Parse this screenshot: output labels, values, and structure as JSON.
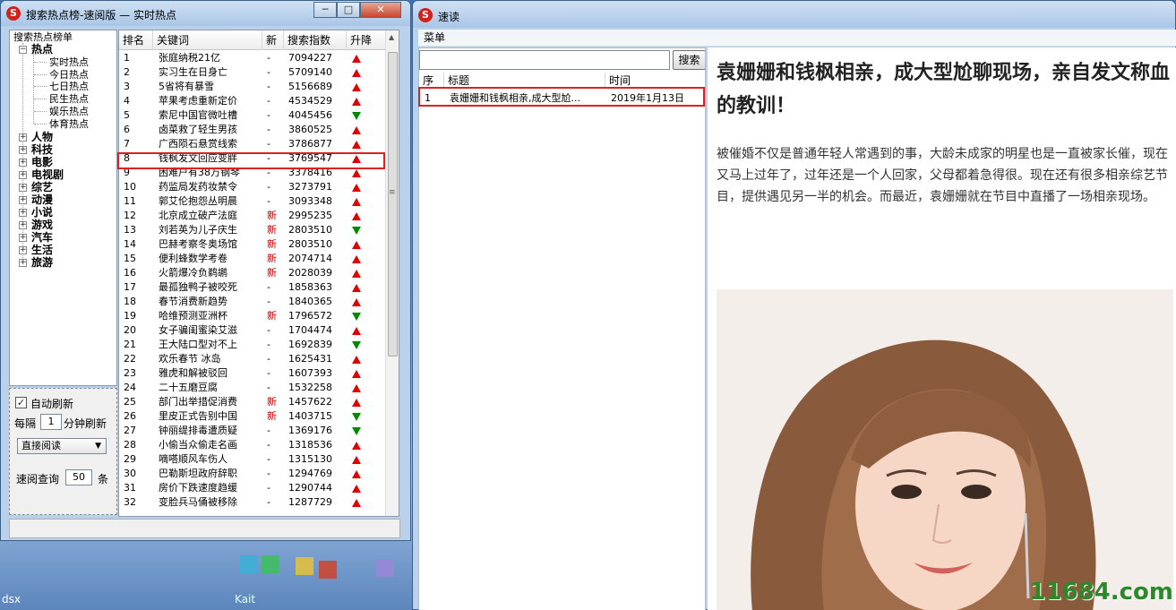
{
  "left_window": {
    "title": "搜索热点榜-速阅版  —  实时热点",
    "min": "─",
    "max": "□",
    "close": "✕"
  },
  "tree": {
    "root": "搜索热点榜单",
    "hot": "热点",
    "hot_children": [
      "实时热点",
      "今日热点",
      "七日热点",
      "民生热点",
      "娱乐热点",
      "体育热点"
    ],
    "categories": [
      "人物",
      "科技",
      "电影",
      "电视剧",
      "综艺",
      "动漫",
      "小说",
      "游戏",
      "汽车",
      "生活",
      "旅游"
    ]
  },
  "options": {
    "auto_refresh": "自动刷新",
    "every": "每隔",
    "interval": "1",
    "minute_refresh": "分钟刷新",
    "mode": "直接阅读",
    "query_label": "速阅查询",
    "count": "50",
    "unit": "条"
  },
  "table": {
    "headers": [
      "排名",
      "关键词",
      "新",
      "搜索指数",
      "升降"
    ],
    "rows": [
      [
        "1",
        "张庭纳税21亿",
        "-",
        "7094227",
        "up"
      ],
      [
        "2",
        "实习生在日身亡",
        "-",
        "5709140",
        "up"
      ],
      [
        "3",
        "5省将有暴雪",
        "-",
        "5156689",
        "up"
      ],
      [
        "4",
        "苹果考虑重新定价",
        "-",
        "4534529",
        "up"
      ],
      [
        "5",
        "索尼中国官微吐槽",
        "-",
        "4045456",
        "down"
      ],
      [
        "6",
        "卤菜救了轻生男孩",
        "-",
        "3860525",
        "up"
      ],
      [
        "7",
        "广西陨石悬赏线索",
        "-",
        "3786877",
        "up"
      ],
      [
        "8",
        "钱枫发文回应变胖",
        "-",
        "3769547",
        "up"
      ],
      [
        "9",
        "困难户有38万钢琴",
        "-",
        "3378416",
        "up"
      ],
      [
        "10",
        "药监局发药妆禁令",
        "-",
        "3273791",
        "up"
      ],
      [
        "11",
        "郭艾伦抱怨丛明晨",
        "-",
        "3093348",
        "up"
      ],
      [
        "12",
        "北京成立破产法庭",
        "新",
        "2995235",
        "up"
      ],
      [
        "13",
        "刘若英为儿子庆生",
        "新",
        "2803510",
        "down"
      ],
      [
        "14",
        "巴赫考察冬奥场馆",
        "新",
        "2803510",
        "up"
      ],
      [
        "15",
        "便利蜂数学考卷",
        "新",
        "2074714",
        "up"
      ],
      [
        "16",
        "火箭爆冷负鹈鹕",
        "新",
        "2028039",
        "up"
      ],
      [
        "17",
        "最孤独鸭子被咬死",
        "-",
        "1858363",
        "up"
      ],
      [
        "18",
        "春节消费新趋势",
        "-",
        "1840365",
        "up"
      ],
      [
        "19",
        "哈维预测亚洲杯",
        "新",
        "1796572",
        "down"
      ],
      [
        "20",
        "女子骗闺蜜染艾滋",
        "-",
        "1704474",
        "up"
      ],
      [
        "21",
        "王大陆口型对不上",
        "-",
        "1692839",
        "down"
      ],
      [
        "22",
        "欢乐春节 冰岛",
        "-",
        "1625431",
        "up"
      ],
      [
        "23",
        "雅虎和解被驳回",
        "-",
        "1607393",
        "up"
      ],
      [
        "24",
        "二十五磨豆腐",
        "-",
        "1532258",
        "up"
      ],
      [
        "25",
        "部门出举措促消费",
        "新",
        "1457622",
        "up"
      ],
      [
        "26",
        "里皮正式告别中国",
        "新",
        "1403715",
        "down"
      ],
      [
        "27",
        "钟丽缇排毒遭质疑",
        "-",
        "1369176",
        "down"
      ],
      [
        "28",
        "小偷当众偷走名画",
        "-",
        "1318536",
        "up"
      ],
      [
        "29",
        "嘀嗒顺风车伤人",
        "-",
        "1315130",
        "up"
      ],
      [
        "30",
        "巴勒斯坦政府辞职",
        "-",
        "1294769",
        "up"
      ],
      [
        "31",
        "房价下跌速度趋缓",
        "-",
        "1290744",
        "up"
      ],
      [
        "32",
        "变脸兵马俑被移除",
        "-",
        "1287729",
        "up"
      ]
    ]
  },
  "right_window": {
    "title": "速读",
    "menu": "菜单",
    "search_button": "搜索",
    "search_value": "",
    "list_headers": [
      "序",
      "标题",
      "时间"
    ],
    "list_rows": [
      [
        "1",
        "袁姗姗和钱枫相亲,成大型尬...",
        "2019年1月13日"
      ]
    ]
  },
  "article": {
    "title": "袁姗姗和钱枫相亲，成大型尬聊现场，亲自发文称血的教训！",
    "body": "被催婚不仅是普通年轻人常遇到的事，大龄未成家的明星也是一直被家长催，现在又马上过年了，过年还是一个人回家，父母都着急得很。现在还有很多相亲综艺节目，提供遇见另一半的机会。而最近，袁姗姗就在节目中直播了一场相亲现场。",
    "watermark": "11684.com"
  },
  "desktop": {
    "left_label": "dsx",
    "mid_label": "Kait"
  }
}
